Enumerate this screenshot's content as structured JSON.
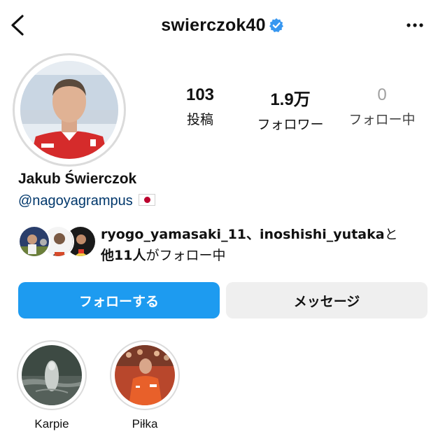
{
  "header": {
    "username": "swierczok40",
    "verified": true,
    "icons": {
      "back": "chevron-left-icon",
      "verified": "verified-badge-icon",
      "more": "more-horizontal-icon"
    }
  },
  "stats": {
    "posts": {
      "value": "103",
      "label": "投稿"
    },
    "followers": {
      "value": "1.9万",
      "label": "フォロワー"
    },
    "following": {
      "value": "0",
      "label": "フォロー中"
    }
  },
  "profile": {
    "full_name": "Jakub Świerczok",
    "mention": "@nagoyagrampus",
    "flag_icon": "japan-flag-icon"
  },
  "followed_by": {
    "names": "ryogo_yamasaki_11、inoshishi_yutaka",
    "connector": "と",
    "others": "他11人",
    "suffix": "がフォロー中"
  },
  "actions": {
    "follow_label": "フォローする",
    "message_label": "メッセージ"
  },
  "highlights": [
    {
      "label": "Karpie"
    },
    {
      "label": "Piłka"
    }
  ],
  "colors": {
    "primary_button": "#1d9bf0",
    "secondary_button": "#efefef",
    "verified": "#3797f0",
    "mention": "#00376b"
  }
}
